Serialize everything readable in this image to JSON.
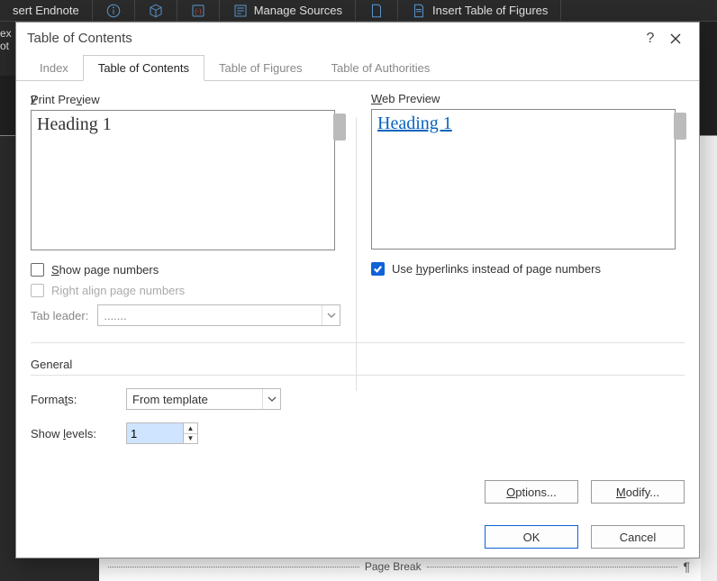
{
  "ribbon": {
    "insert_endnote": "sert Endnote",
    "manage_sources": "Manage Sources",
    "insert_tof": "Insert Table of Figures"
  },
  "left_gutter": "ex\not",
  "dialog": {
    "title": "Table of Contents",
    "help": "?",
    "tabs": {
      "index": "Index",
      "toc": "Table of Contents",
      "tof": "Table of Figures",
      "toa": "Table of Authorities"
    },
    "print_preview_label": "Print Preview",
    "web_preview_label": "Web Preview",
    "print_preview_content": "Heading 1",
    "web_preview_content": "Heading 1",
    "show_page_numbers": "Show page numbers",
    "right_align": "Right align page numbers",
    "tab_leader_label": "Tab leader:",
    "tab_leader_value": ".......",
    "use_hyperlinks": "Use hyperlinks instead of page numbers",
    "general_label": "General",
    "formats_label": "Formats:",
    "formats_value": "From template",
    "show_levels_label": "Show levels:",
    "show_levels_value": "1",
    "options_btn": "Options...",
    "modify_btn": "Modify...",
    "ok_btn": "OK",
    "cancel_btn": "Cancel"
  },
  "page_break": "Page Break"
}
